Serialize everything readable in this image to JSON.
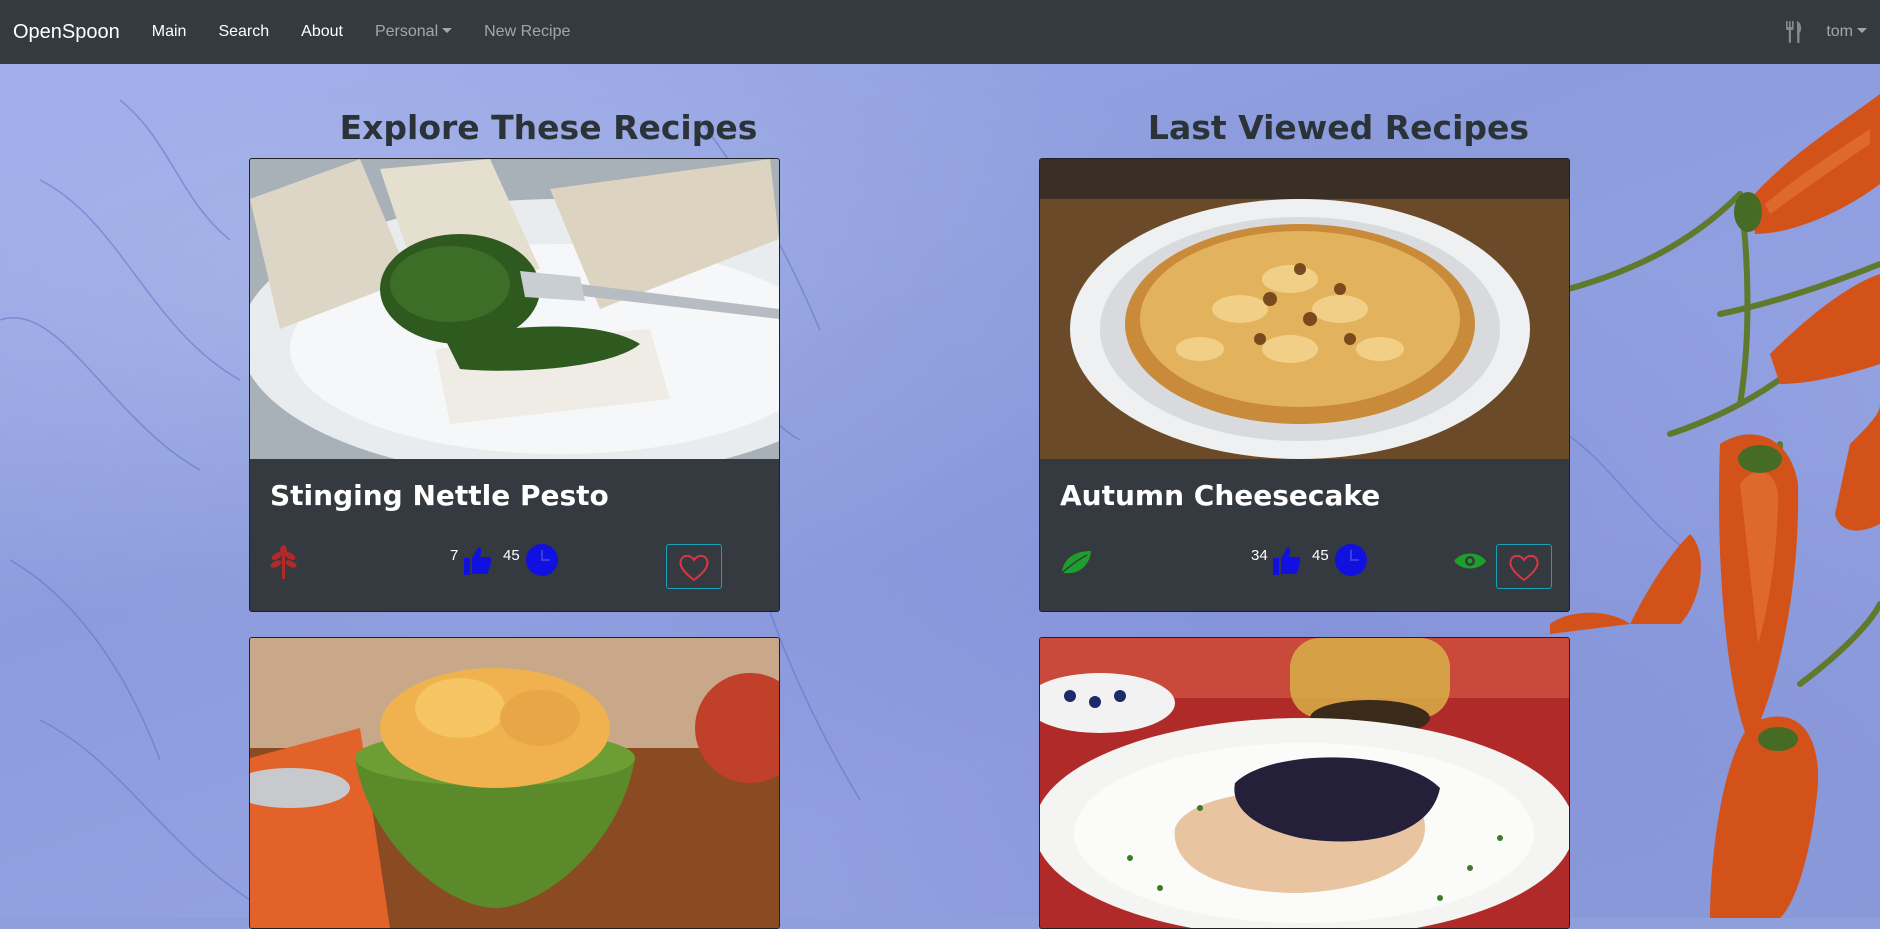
{
  "navbar": {
    "brand": "OpenSpoon",
    "links": [
      "Main",
      "Search",
      "About"
    ],
    "personal": "Personal",
    "new_recipe": "New Recipe",
    "user": "tom"
  },
  "columns": {
    "explore_title": "Explore These Recipes",
    "last_viewed_title": "Last Viewed Recipes"
  },
  "cards": [
    {
      "title": "Stinging Nettle Pesto",
      "likes": "7",
      "time": "45",
      "diet": "herb-leaf-icon",
      "viewed": false
    },
    {
      "title": "Autumn Cheesecake",
      "likes": "34",
      "time": "45",
      "diet": "green-leaf-icon",
      "viewed": true
    },
    {
      "title": "",
      "image": "pumpkin-ice-cream"
    },
    {
      "title": "",
      "image": "pork-chop-with-berry-sauce"
    }
  ],
  "colors": {
    "navbar": "#343a40",
    "card": "#343a40",
    "like_blue": "#1010e0",
    "heart_red": "#dc3545",
    "favorite_border": "#17a2b8",
    "diet_red": "#b02a2a",
    "diet_green": "#1e9e2a",
    "eye_green": "#1e9e2a"
  }
}
